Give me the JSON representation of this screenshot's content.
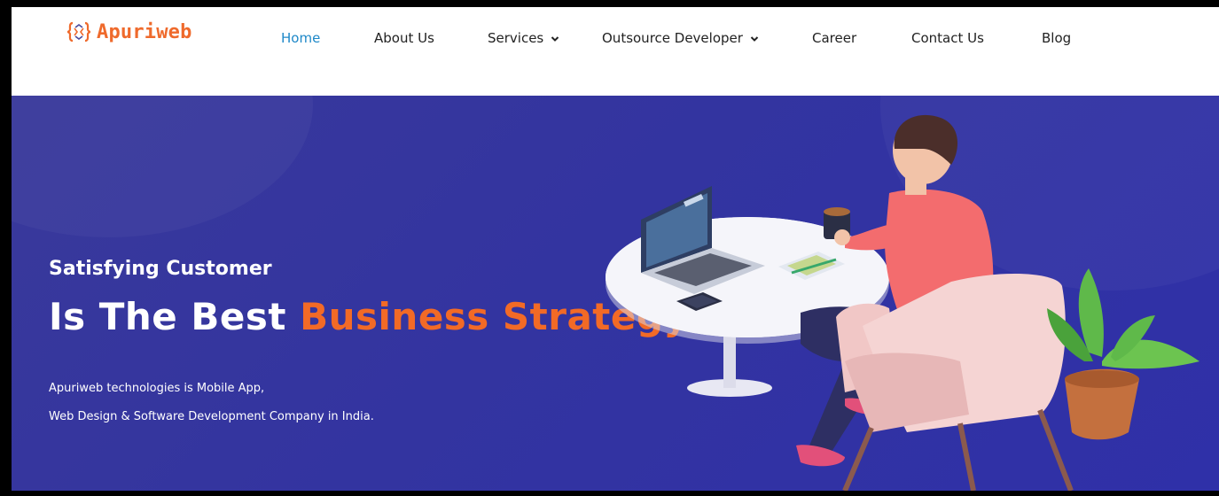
{
  "brand": {
    "name": "Apuriweb",
    "color": "#ef6a2c"
  },
  "nav": {
    "items": [
      {
        "label": "Home",
        "active": true,
        "has_dropdown": false
      },
      {
        "label": "About Us",
        "active": false,
        "has_dropdown": false
      },
      {
        "label": "Services",
        "active": false,
        "has_dropdown": true
      },
      {
        "label": "Outsource Developer",
        "active": false,
        "has_dropdown": true
      },
      {
        "label": "Career",
        "active": false,
        "has_dropdown": false
      },
      {
        "label": "Contact Us",
        "active": false,
        "has_dropdown": false
      },
      {
        "label": "Blog",
        "active": false,
        "has_dropdown": false
      }
    ],
    "active_color": "#1e88c8",
    "icons": {
      "dropdown": "chevron-down-icon"
    }
  },
  "hero": {
    "subtitle": "Satisfying Customer",
    "title_white": "Is The Best ",
    "title_orange": "Business Strategy",
    "description_lines": [
      "Apuriweb technologies is Mobile App,",
      "Web Design & Software Development Company in India."
    ],
    "background_color": "#3334a0",
    "accent_color": "#f26a26",
    "illustration": "person-working-laptop-illustration"
  }
}
